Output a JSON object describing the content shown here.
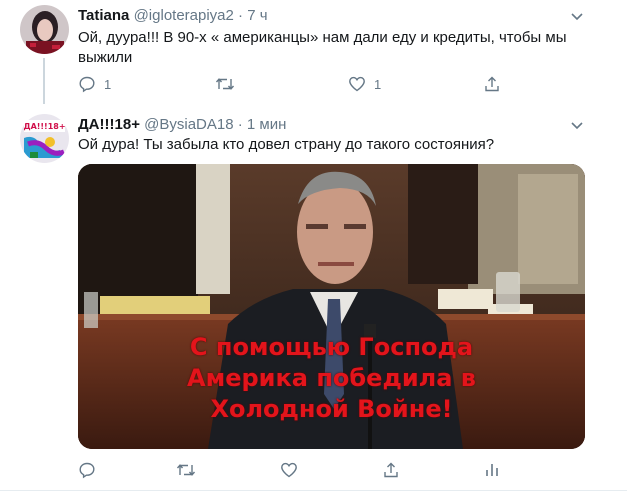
{
  "tweets": [
    {
      "name": "Tatiana",
      "handle": "@igloterapiya2",
      "separator": "·",
      "time": "7 ч",
      "text_line1": "Ой, дуура!!! В 90-х « американцы» нам дали еду и кредиты, чтобы мы",
      "text_line2": "выжили",
      "reply_count": "1",
      "like_count": "1"
    },
    {
      "name": "ДА!!!18+",
      "handle": "@BysiaDA18",
      "separator": "·",
      "time": "1 мин",
      "text": "Ой дура! Ты забыла кто довел страну до такого состояния?",
      "avatar_text": "ДА!!!18+"
    }
  ],
  "media": {
    "caption_line1": "С помощью Господа",
    "caption_line2": "Америка победила в",
    "caption_line3": "Холодной Войне!"
  },
  "colors": {
    "text_primary": "#14171a",
    "text_secondary": "#657786",
    "caption_red": "#e3141b",
    "divider": "#e6ecf0"
  }
}
